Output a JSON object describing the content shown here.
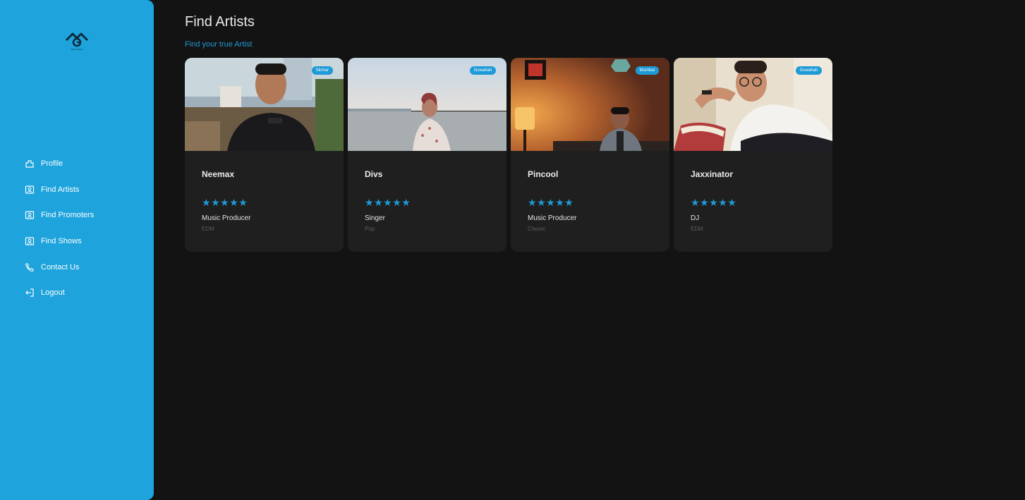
{
  "brand": {
    "logo_caption": "MELODIST"
  },
  "sidebar": {
    "items": [
      {
        "label": "Profile",
        "icon": "profile-icon"
      },
      {
        "label": "Find Artists",
        "icon": "contact-card-icon"
      },
      {
        "label": "Find Promoters",
        "icon": "contact-card-icon"
      },
      {
        "label": "Find Shows",
        "icon": "contact-card-icon"
      },
      {
        "label": "Contact Us",
        "icon": "phone-icon"
      },
      {
        "label": "Logout",
        "icon": "logout-icon"
      }
    ]
  },
  "page": {
    "title": "Find Artists",
    "subtitle": "Find your true Artist"
  },
  "artists": [
    {
      "name": "Neemax",
      "location": "Silchar",
      "rating": 5,
      "role": "Music Producer",
      "genre": "EDM"
    },
    {
      "name": "Divs",
      "location": "Guwahati",
      "rating": 5,
      "role": "Singer",
      "genre": "Pop"
    },
    {
      "name": "Pincool",
      "location": "Mumbai",
      "rating": 5,
      "role": "Music Producer",
      "genre": "Classic"
    },
    {
      "name": "Jaxxinator",
      "location": "Guwahati",
      "rating": 5,
      "role": "DJ",
      "genre": "EDM"
    }
  ],
  "colors": {
    "sidebar": "#1ea3dc",
    "background": "#131313",
    "card": "#1f1f1f",
    "accent": "#1e9ad6"
  }
}
